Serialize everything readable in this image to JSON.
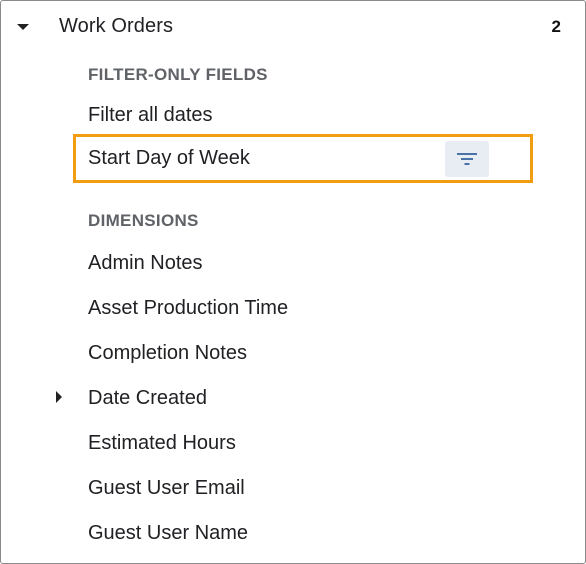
{
  "header": {
    "title": "Work Orders",
    "count": "2"
  },
  "filter_only": {
    "label": "FILTER-ONLY FIELDS",
    "items": [
      "Filter all dates",
      "Start Day of Week"
    ]
  },
  "dimensions": {
    "label": "DIMENSIONS",
    "items": [
      "Admin Notes",
      "Asset Production Time",
      "Completion Notes",
      "Date Created",
      "Estimated Hours",
      "Guest User Email",
      "Guest User Name"
    ]
  },
  "icons": {
    "expand": "caret-down-icon",
    "collapsed": "caret-right-icon",
    "filter": "filter-icon"
  },
  "colors": {
    "highlight_border": "#f29d0f",
    "filter_button_bg": "#e8edf4",
    "filter_icon": "#4a72a8"
  }
}
